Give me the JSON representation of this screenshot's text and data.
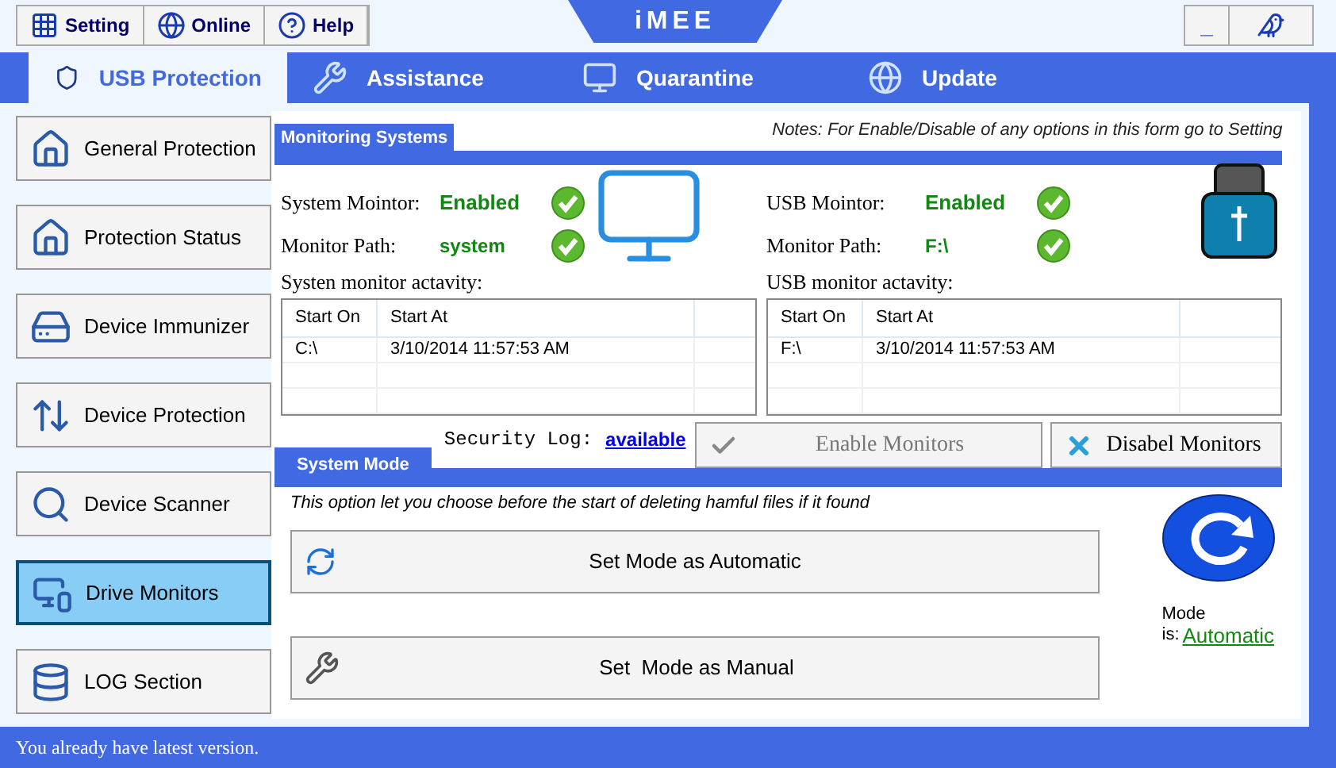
{
  "toolbar": [
    {
      "label": "Setting",
      "kind": "setting"
    },
    {
      "label": "Online",
      "kind": "online"
    },
    {
      "label": "Help",
      "kind": "help"
    }
  ],
  "logo": "iMEE",
  "window_controls": {
    "minimize": "_"
  },
  "tabs": [
    {
      "label": "USB Protection",
      "selected": true,
      "kind": "shield"
    },
    {
      "label": "Assistance",
      "selected": false,
      "kind": "tools"
    },
    {
      "label": "Quarantine",
      "selected": false,
      "kind": "monitor"
    },
    {
      "label": "Update",
      "selected": false,
      "kind": "globe"
    }
  ],
  "sidebar": {
    "items": [
      {
        "label": "General Protection",
        "selected": false,
        "kind": "house"
      },
      {
        "label": "Protection Status",
        "selected": false,
        "kind": "home"
      },
      {
        "label": "Device Immunizer",
        "selected": false,
        "kind": "drive"
      },
      {
        "label": "Device Protection",
        "selected": false,
        "kind": "arrows"
      },
      {
        "label": "Device Scanner",
        "selected": false,
        "kind": "scanner"
      },
      {
        "label": "Drive Monitors",
        "selected": true,
        "kind": "monitors"
      },
      {
        "label": "LOG Section",
        "selected": false,
        "kind": "database"
      }
    ]
  },
  "monitoring": {
    "title": "Monitoring Systems",
    "note": "Notes: For Enable/Disable of any options in this form go to Setting",
    "panels": [
      {
        "monitor_label": "System Mointor:",
        "monitor_value": "Enabled",
        "monitor_ok": true,
        "path_label": "Monitor Path:",
        "path_value": "system",
        "path_ok": true,
        "activity_label": "Systen monitor actavity:",
        "columns": [
          "Start On",
          "Start At"
        ],
        "rows": [
          [
            "C:\\",
            "3/10/2014 11:57:53 AM"
          ]
        ]
      },
      {
        "monitor_label": "USB Mointor:",
        "monitor_value": "Enabled",
        "monitor_ok": true,
        "path_label": "Monitor Path:",
        "path_value": "F:\\",
        "path_ok": true,
        "activity_label": "USB monitor actavity:",
        "columns": [
          "Start On",
          "Start At"
        ],
        "rows": [
          [
            "F:\\",
            "3/10/2014 11:57:53 AM"
          ]
        ]
      }
    ]
  },
  "security_log": {
    "label": "Security Log:",
    "value": "available"
  },
  "monitor_buttons": [
    {
      "label": "Enable Monitors",
      "disabled": true,
      "kind": "check"
    },
    {
      "label": "Disabel Monitors",
      "disabled": false,
      "kind": "cross"
    }
  ],
  "system_mode": {
    "title": "System Mode",
    "description": "This option let you choose before the start of deleting hamful files if it found",
    "buttons": [
      {
        "label": "Set Mode as Automatic",
        "kind": "auto"
      },
      {
        "label": "Set  Mode as Manual",
        "kind": "manual"
      }
    ],
    "mode_label": "Mode",
    "mode_prefix": "is:",
    "mode_value": "Automatic"
  },
  "status_bar": "You already have latest version."
}
